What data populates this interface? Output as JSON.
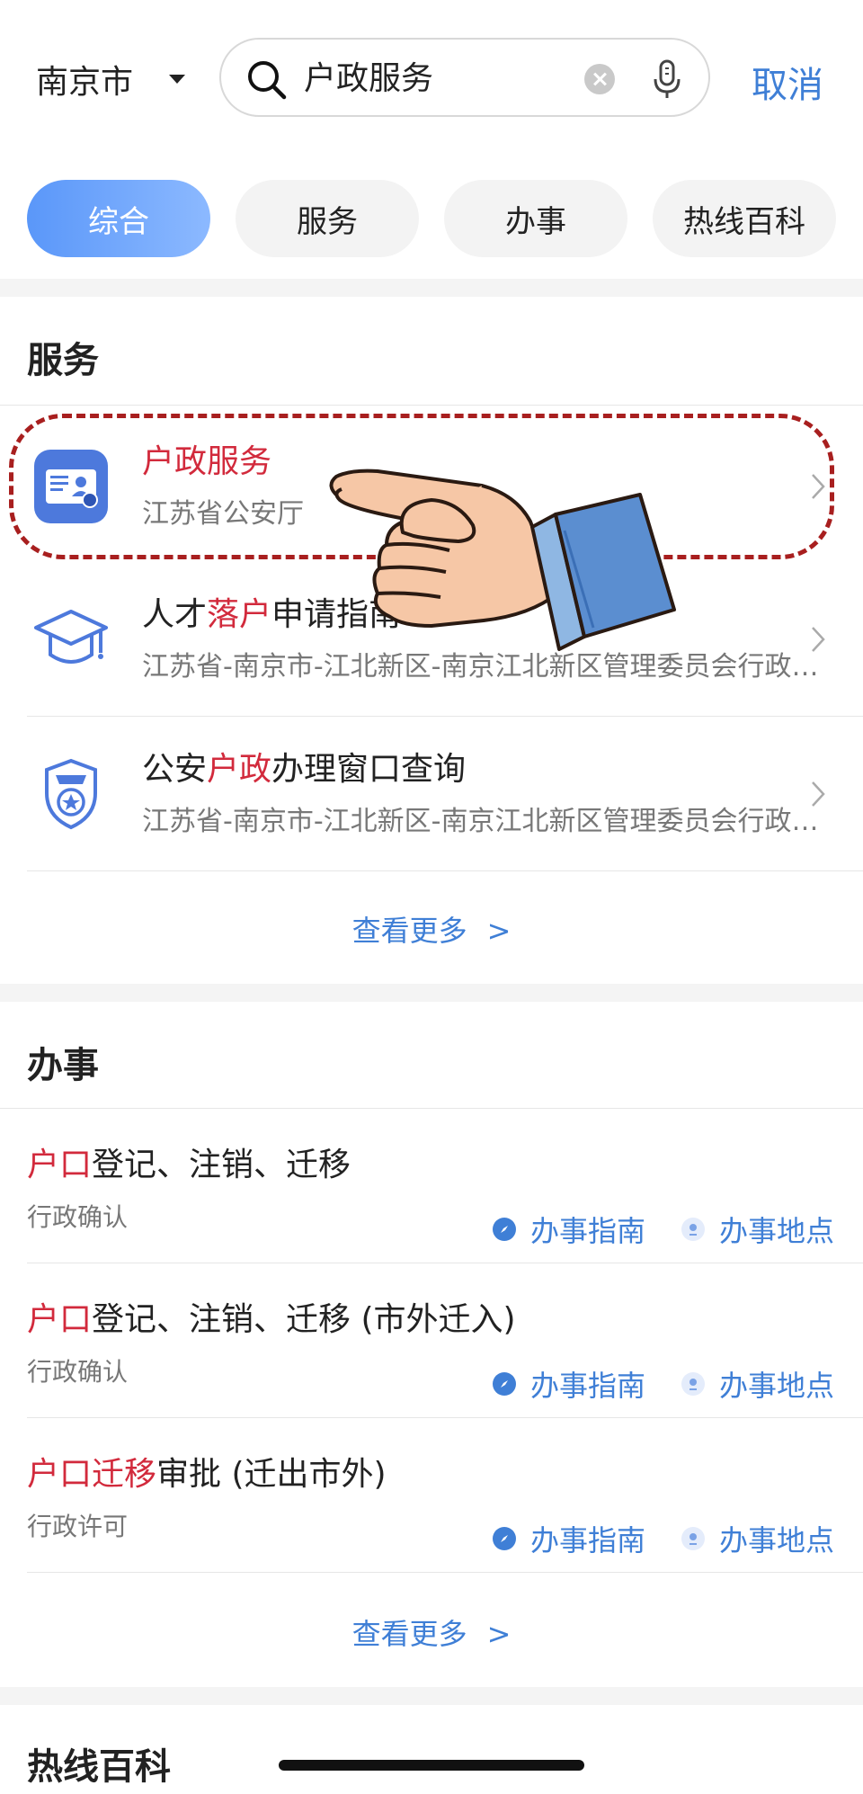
{
  "header": {
    "city": "南京市",
    "search_value": "户政服务",
    "cancel_label": "取消"
  },
  "tabs": [
    {
      "label": "综合",
      "active": true
    },
    {
      "label": "服务",
      "active": false
    },
    {
      "label": "办事",
      "active": false
    },
    {
      "label": "热线百科",
      "active": false
    }
  ],
  "services": {
    "title": "服务",
    "items": [
      {
        "title_hl": "户政服务",
        "title_rest": "",
        "subtitle": "江苏省公安厅",
        "icon": "id-card-icon"
      },
      {
        "title_pre": "人才",
        "title_hl": "落户",
        "title_rest": "申请指南",
        "subtitle": "江苏省-南京市-江北新区-南京江北新区管理委员会行政…",
        "icon": "graduation-cap-icon"
      },
      {
        "title_pre": "公安",
        "title_hl": "户政",
        "title_rest": "办理窗口查询",
        "subtitle": "江苏省-南京市-江北新区-南京江北新区管理委员会行政…",
        "icon": "police-badge-icon"
      }
    ],
    "more_label": "查看更多",
    "more_arrow": ">"
  },
  "work": {
    "title": "办事",
    "items": [
      {
        "title_hl": "户口",
        "title_rest": "登记、注销、迁移",
        "type": "行政确认"
      },
      {
        "title_hl": "户口",
        "title_rest": "登记、注销、迁移 (市外迁入)",
        "type": "行政确认"
      },
      {
        "title_hl": "户口迁移",
        "title_rest": "审批 (迁出市外)",
        "type": "行政许可"
      }
    ],
    "guide_label": "办事指南",
    "place_label": "办事地点",
    "more_label": "查看更多",
    "more_arrow": ">"
  },
  "hotline": {
    "title": "热线百科"
  },
  "colors": {
    "accent": "#3f7fd6",
    "highlight": "#d22a3c",
    "annotation": "#a81f1f"
  }
}
